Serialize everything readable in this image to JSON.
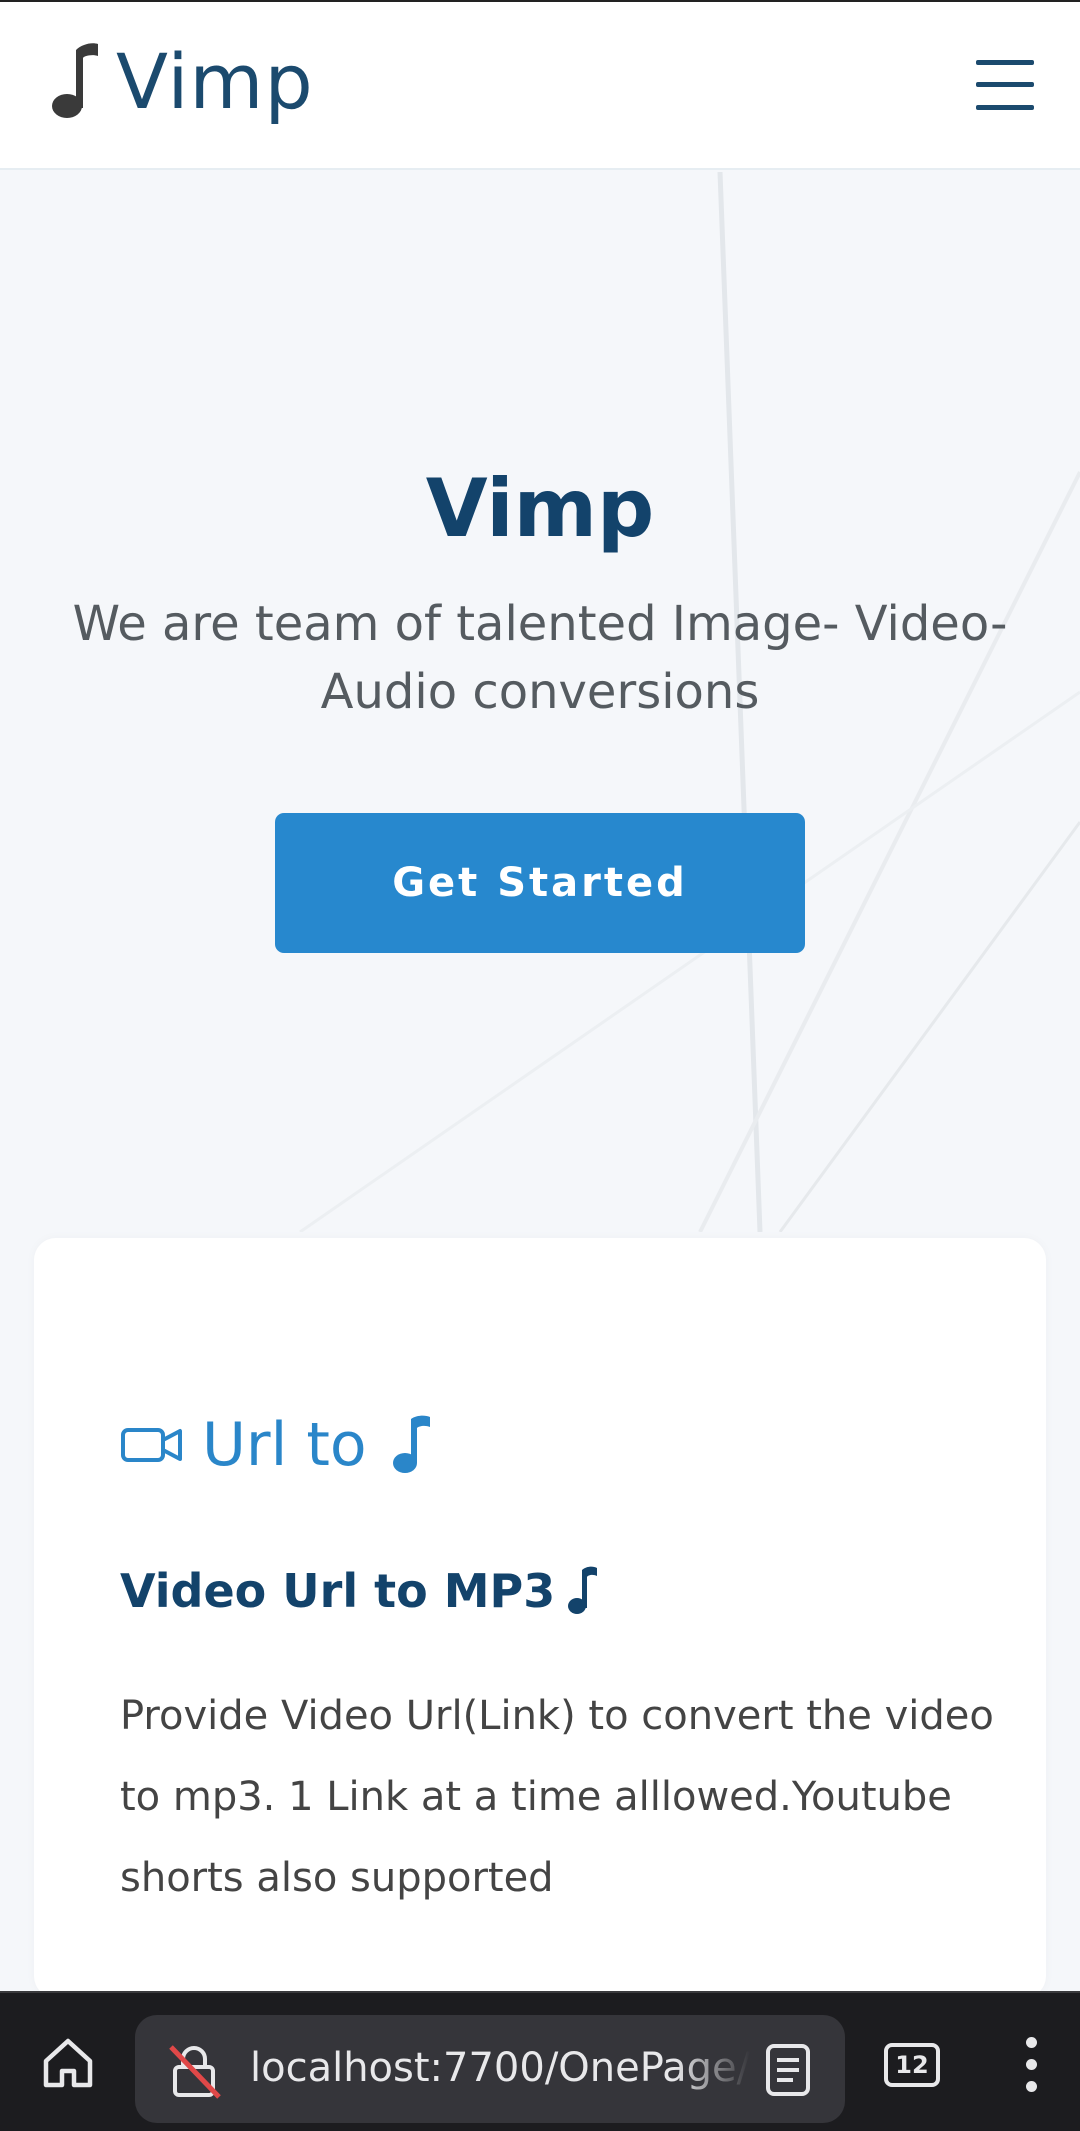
{
  "header": {
    "brand": "Vimp",
    "brand_icon": "music-note-icon",
    "menu_icon": "hamburger-menu-icon"
  },
  "hero": {
    "title": "Vimp",
    "subtitle": "We are team of talented Image- Video- Audio conversions",
    "cta_label": "Get Started"
  },
  "card": {
    "head_text": "Url to",
    "head_icons": [
      "video-camera-icon",
      "music-note-icon"
    ],
    "title": "Video Url to MP3",
    "description": "Provide Video Url(Link) to convert the video to mp3. 1 Link at a time alllowed.Youtube shorts also supported"
  },
  "browser": {
    "url": "localhost:7700/OnePage/",
    "tab_count": "12"
  },
  "colors": {
    "brand_dark": "#13436b",
    "accent": "#2788ce",
    "link_blue": "#2a86c9",
    "browser_bar": "#1c1c1f"
  }
}
